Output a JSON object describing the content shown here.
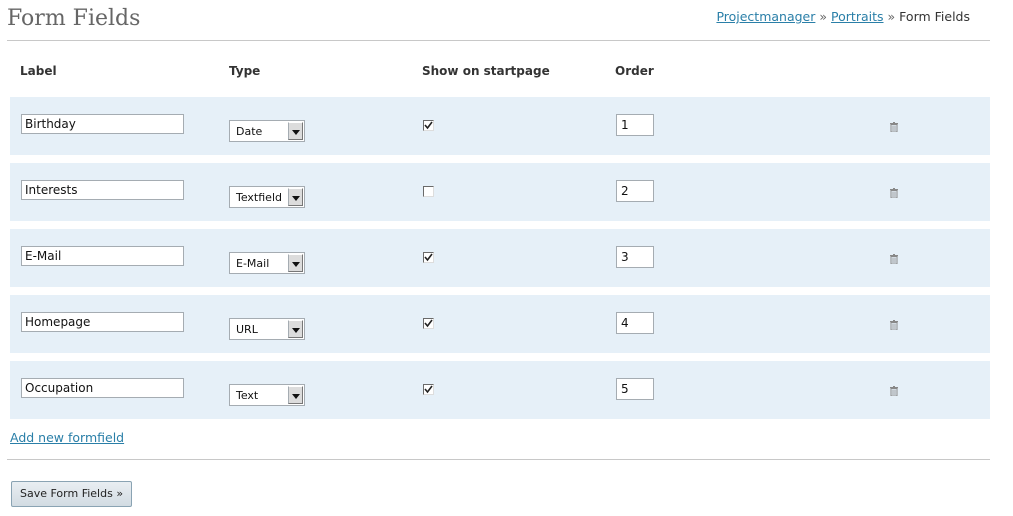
{
  "header": {
    "title": "Form Fields",
    "breadcrumb": [
      {
        "label": "Projectmanager",
        "link": true
      },
      {
        "label": "Portraits",
        "link": true
      },
      {
        "label": "Form Fields",
        "link": false
      }
    ],
    "separator": "»"
  },
  "columns": {
    "label": "Label",
    "type": "Type",
    "show": "Show on startpage",
    "order": "Order"
  },
  "rows": [
    {
      "label": "Birthday",
      "type": "Date",
      "show": true,
      "order": "1"
    },
    {
      "label": "Interests",
      "type": "Textfield",
      "show": false,
      "order": "2"
    },
    {
      "label": "E-Mail",
      "type": "E-Mail",
      "show": true,
      "order": "3"
    },
    {
      "label": "Homepage",
      "type": "URL",
      "show": true,
      "order": "4"
    },
    {
      "label": "Occupation",
      "type": "Text",
      "show": true,
      "order": "5"
    }
  ],
  "row_icon": "trash-icon",
  "colors": {
    "row_bg": "#e6f0f8",
    "link": "#2a7fa8"
  },
  "add_link": "Add new formfield",
  "save_button": "Save Form Fields »"
}
